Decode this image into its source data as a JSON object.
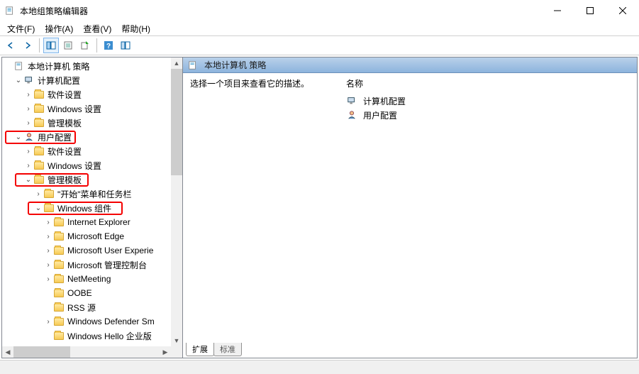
{
  "window_title": "本地组策略编辑器",
  "menu": {
    "file": "文件(F)",
    "action": "操作(A)",
    "view": "查看(V)",
    "help": "帮助(H)"
  },
  "tree": {
    "root": "本地计算机 策略",
    "computer": "计算机配置",
    "comp_soft": "软件设置",
    "comp_win": "Windows 设置",
    "comp_admin": "管理模板",
    "user": "用户配置",
    "user_soft": "软件设置",
    "user_win": "Windows 设置",
    "user_admin": "管理模板",
    "start_menu": "\"开始\"菜单和任务栏",
    "win_comp": "Windows 组件",
    "ie": "Internet Explorer",
    "edge": "Microsoft Edge",
    "mue": "Microsoft User Experie",
    "mmc": "Microsoft 管理控制台",
    "netmeeting": "NetMeeting",
    "oobe": "OOBE",
    "rss": "RSS 源",
    "wds": "Windows Defender Sm",
    "whello": "Windows Hello 企业版"
  },
  "result": {
    "header": "本地计算机 策略",
    "desc": "选择一个项目来查看它的描述。",
    "name_hdr": "名称",
    "items": {
      "comp": "计算机配置",
      "user": "用户配置"
    }
  },
  "tabs": {
    "extended": "扩展",
    "standard": "标准"
  }
}
